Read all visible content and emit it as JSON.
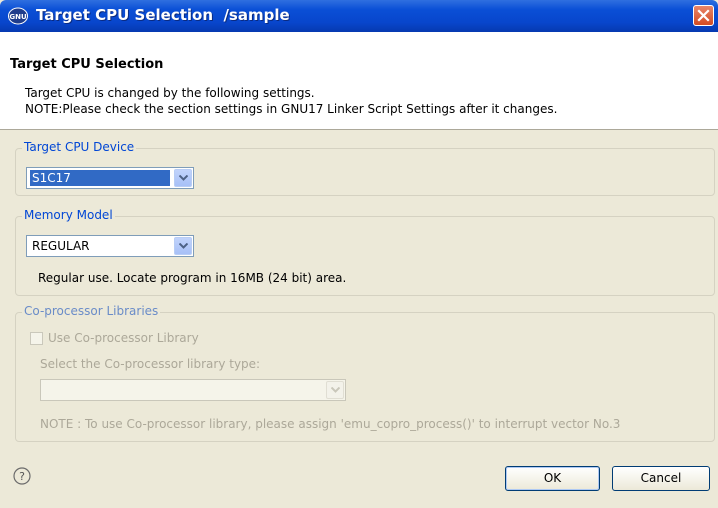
{
  "window": {
    "title": "Target CPU Selection  /sample"
  },
  "header": {
    "title": "Target CPU Selection",
    "message_line1": "Target CPU is changed by the following settings.",
    "message_line2": "NOTE:Please check the section settings in GNU17 Linker Script Settings after it changes."
  },
  "cpu_device": {
    "legend": "Target CPU Device",
    "selected": "S1C17"
  },
  "memory_model": {
    "legend": "Memory Model",
    "selected": "REGULAR",
    "description": "Regular use. Locate program in 16MB (24 bit) area."
  },
  "coprocessor": {
    "legend": "Co-processor Libraries",
    "checkbox_label": "Use Co-processor Library",
    "checked": false,
    "type_label": "Select the Co-processor library type:",
    "type_value": "",
    "note": "NOTE : To use Co-processor library, please assign 'emu_copro_process()' to interrupt vector No.3"
  },
  "footer": {
    "ok_label": "OK",
    "cancel_label": "Cancel"
  },
  "colors": {
    "title_bar": "#0a4fd6",
    "legend_text": "#0046d5",
    "selection": "#316ac5",
    "close_button": "#d24b23"
  },
  "icons": {
    "app": "gnu-app-icon",
    "close": "close-icon",
    "dropdown": "chevron-down-icon",
    "help": "help-icon"
  }
}
